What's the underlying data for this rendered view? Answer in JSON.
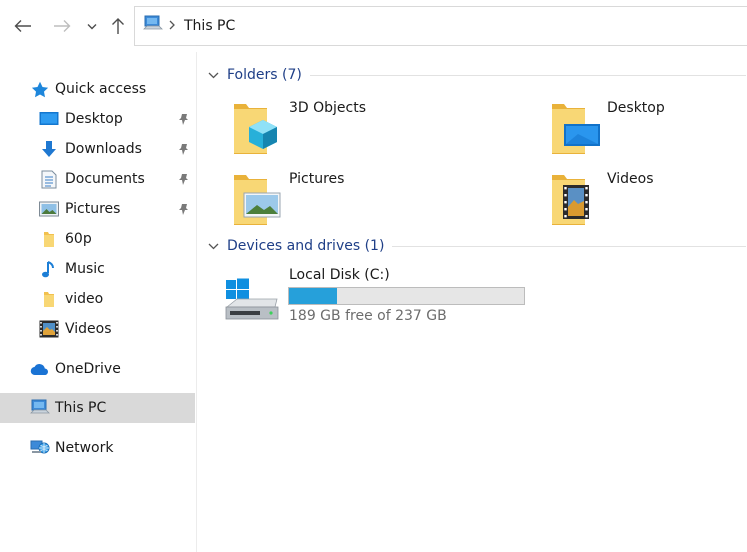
{
  "address_bar": {
    "location_icon": "this-pc-icon",
    "path": "This PC"
  },
  "sidebar": {
    "quick_access": {
      "label": "Quick access",
      "icon": "star-icon"
    },
    "pinned": [
      {
        "label": "Desktop",
        "icon": "desktop-icon",
        "pinned": true
      },
      {
        "label": "Downloads",
        "icon": "download-arrow-icon",
        "pinned": true
      },
      {
        "label": "Documents",
        "icon": "documents-icon",
        "pinned": true
      },
      {
        "label": "Pictures",
        "icon": "pictures-icon",
        "pinned": true
      },
      {
        "label": "60p",
        "icon": "folder-icon",
        "pinned": false
      },
      {
        "label": "Music",
        "icon": "music-note-icon",
        "pinned": false
      },
      {
        "label": "video",
        "icon": "folder-icon",
        "pinned": false
      },
      {
        "label": "Videos",
        "icon": "videos-icon",
        "pinned": false
      }
    ],
    "onedrive": {
      "label": "OneDrive",
      "icon": "cloud-icon"
    },
    "this_pc": {
      "label": "This PC",
      "icon": "this-pc-icon",
      "selected": true
    },
    "network": {
      "label": "Network",
      "icon": "network-icon"
    }
  },
  "folders_group": {
    "header": "Folders (7)",
    "items": [
      {
        "label": "3D Objects",
        "icon": "3d-objects-folder-icon"
      },
      {
        "label": "Desktop",
        "icon": "desktop-folder-icon"
      },
      {
        "label": "Pictures",
        "icon": "pictures-folder-icon"
      },
      {
        "label": "Videos",
        "icon": "videos-folder-icon"
      }
    ]
  },
  "devices_group": {
    "header": "Devices and drives (1)",
    "drives": [
      {
        "name": "Local Disk (C:)",
        "icon": "windows-drive-icon",
        "free_text": "189 GB free of 237 GB",
        "used_fraction": 0.2025,
        "bar_color": "#26a0da"
      }
    ]
  },
  "colors": {
    "accent": "#26a0da",
    "group_header": "#1f3f87",
    "selection": "#d9d9d9"
  }
}
